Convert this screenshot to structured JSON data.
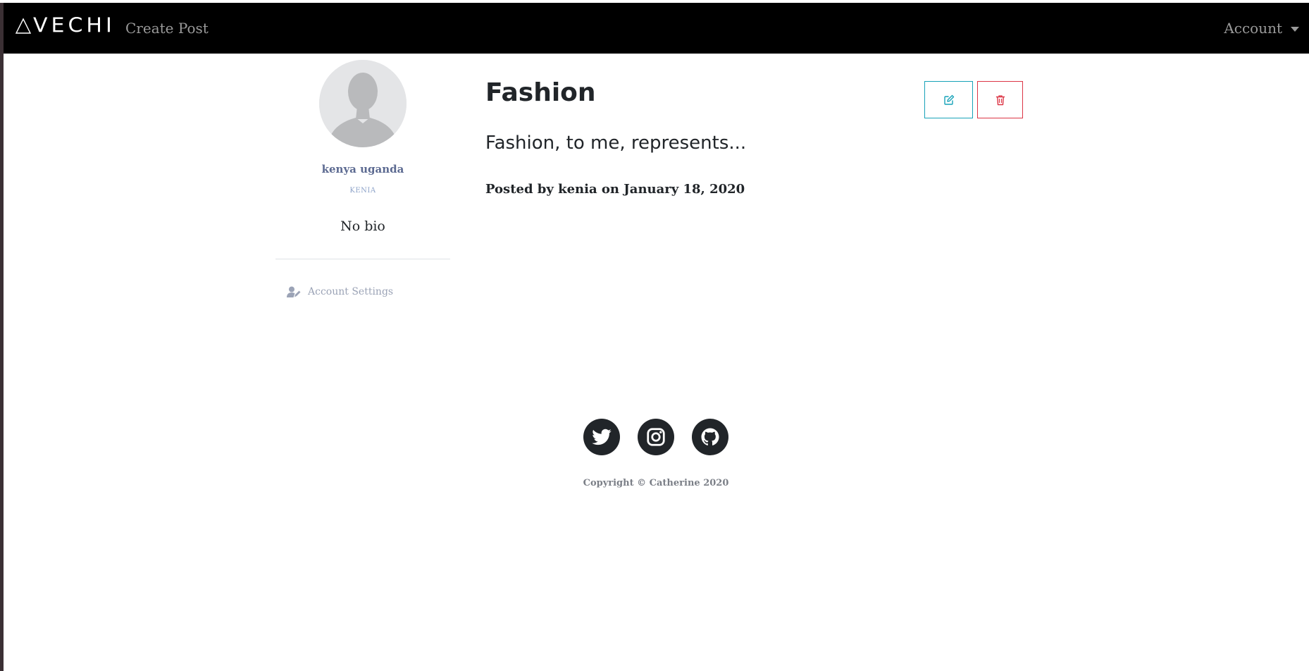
{
  "navbar": {
    "brand": "VECHI",
    "create_post_label": "Create Post",
    "account_label": "Account"
  },
  "profile": {
    "full_name": "kenya uganda",
    "username": "KENIA",
    "bio": "No bio",
    "settings_label": "Account Settings"
  },
  "post": {
    "title": "Fashion",
    "body": "Fashion, to me, represents...",
    "meta": "Posted by kenia on January 18, 2020"
  },
  "actions": {
    "edit_icon": "edit-icon",
    "delete_icon": "trash-icon"
  },
  "footer": {
    "social": [
      "twitter-icon",
      "instagram-icon",
      "github-icon"
    ],
    "copyright": "Copyright © Catherine 2020"
  },
  "colors": {
    "navbar_bg": "#000000",
    "edit_accent": "#17a2b8",
    "delete_accent": "#dc3545",
    "username": "#5c6a91",
    "social_bg": "#212529"
  }
}
